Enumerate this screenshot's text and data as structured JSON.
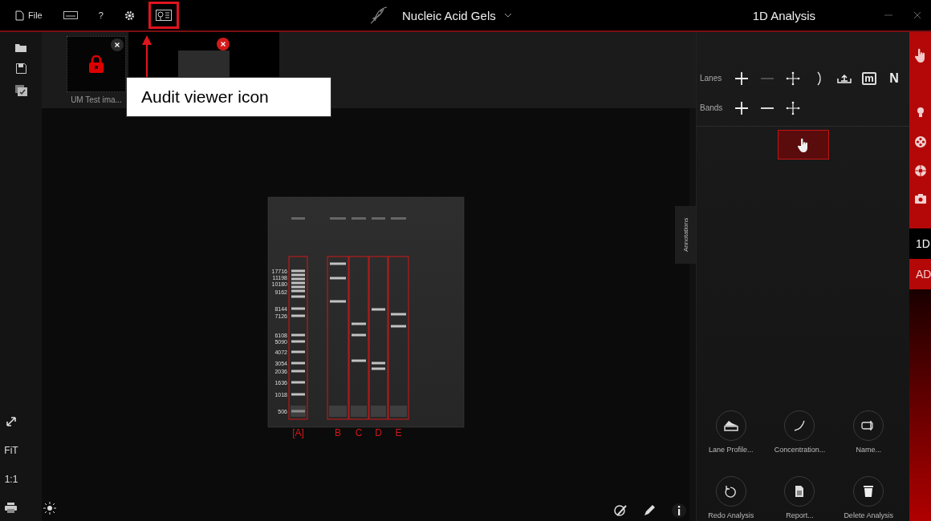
{
  "top_bar": {
    "menu": [
      {
        "kind": "file",
        "label": "File",
        "highlighted": false
      },
      {
        "kind": "keyboard",
        "highlighted": false
      },
      {
        "kind": "help",
        "label": "?",
        "highlighted": false
      },
      {
        "kind": "settings",
        "highlighted": false
      },
      {
        "kind": "audit",
        "highlighted": true
      }
    ],
    "app_title": "Nucleic Acid Gels",
    "view_title": "1D Analysis"
  },
  "callout": {
    "text": "Audit viewer icon"
  },
  "thumbnails": [
    {
      "label": "UM Test ima...",
      "selected": false,
      "locked": true
    },
    {
      "selected": true,
      "locked": false
    }
  ],
  "left_toolbar": {
    "fit": "FiT",
    "actual_size": "1:1"
  },
  "gel": {
    "marker_labels": [
      "17716",
      "11198",
      "10180",
      "9162",
      "8144",
      "7126",
      "6108",
      "5090",
      "4072",
      "3054",
      "2036",
      "1636",
      "1018",
      "506"
    ],
    "lanes": [
      {
        "label": "[A]"
      },
      {
        "label": "B"
      },
      {
        "label": "C"
      },
      {
        "label": "D"
      },
      {
        "label": "E"
      }
    ]
  },
  "annotations_tab": "Annotations",
  "analysis_panel": {
    "lanes_label": "Lanes",
    "lane_tools": [
      {
        "kind": "add",
        "disabled": false
      },
      {
        "kind": "remove",
        "disabled": true
      },
      {
        "kind": "move",
        "disabled": false
      },
      {
        "kind": "curve",
        "disabled": false
      },
      {
        "kind": "baseline",
        "disabled": false
      },
      {
        "kind": "marker",
        "label": "m",
        "disabled": false
      },
      {
        "kind": "normalize",
        "label": "N",
        "disabled": false
      }
    ],
    "bands_label": "Bands",
    "band_tools": [
      {
        "kind": "add",
        "disabled": false
      },
      {
        "kind": "remove",
        "disabled": false
      },
      {
        "kind": "move",
        "disabled": false
      }
    ],
    "select_tool": {
      "selected": true
    },
    "actions": [
      {
        "kind": "lane-profile",
        "label": "Lane Profile..."
      },
      {
        "kind": "concentration",
        "label": "Concentration..."
      },
      {
        "kind": "name",
        "label": "Name..."
      },
      {
        "kind": "redo",
        "label": "Redo Analysis"
      },
      {
        "kind": "report",
        "label": "Report..."
      },
      {
        "kind": "delete",
        "label": "Delete Analysis"
      }
    ]
  },
  "side_tabs": [
    {
      "label": "1D",
      "selected": true
    },
    {
      "label": "AD",
      "selected": false
    }
  ]
}
